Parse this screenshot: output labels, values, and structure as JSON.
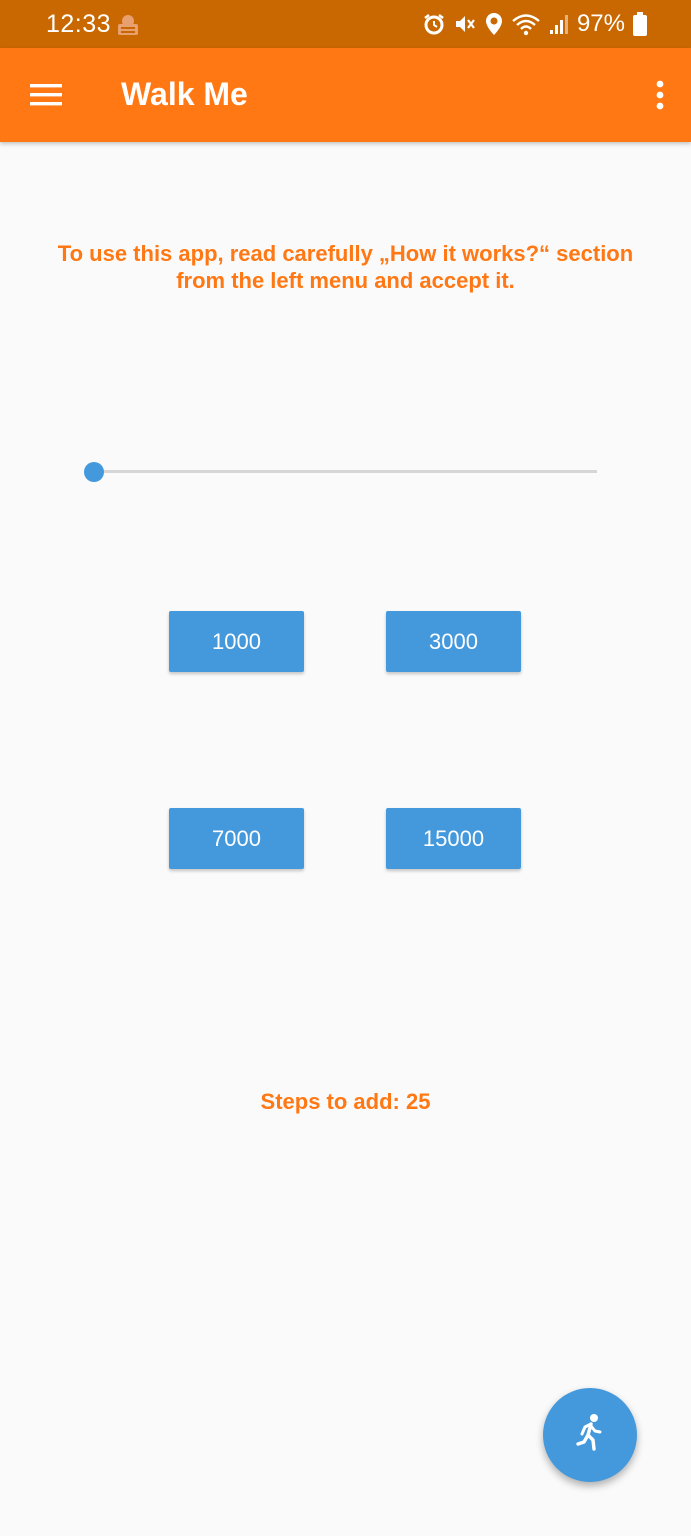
{
  "status_bar": {
    "time": "12:33",
    "battery": "97%",
    "icons": [
      "notification-icon",
      "alarm-icon",
      "mute-icon",
      "location-icon",
      "wifi-icon",
      "signal-icon",
      "battery-icon"
    ]
  },
  "app_bar": {
    "title": "Walk Me",
    "menu_icon": "hamburger-menu-icon",
    "overflow_icon": "more-vert-icon",
    "background": "#ff7814"
  },
  "main": {
    "intro_text": "To use this app, read carefully „How it works?“ section from the left menu and accept it.",
    "slider": {
      "value": 0
    },
    "presets": [
      "1000",
      "3000",
      "7000",
      "15000"
    ],
    "steps_label": "Steps to add:",
    "steps_value": "25"
  },
  "fab": {
    "icon": "walking-person-icon"
  },
  "colors": {
    "accent": "#ff7814",
    "status_bar": "#c96800",
    "button": "#4499dd",
    "background": "#fafafa"
  }
}
